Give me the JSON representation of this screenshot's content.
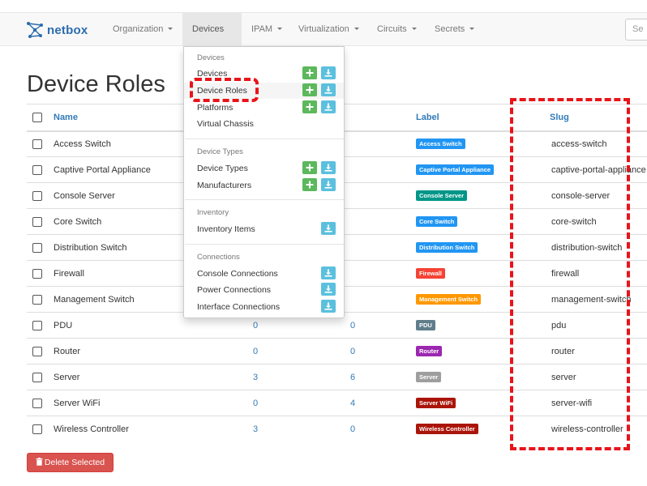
{
  "navbar": {
    "brand": "netbox",
    "items": [
      {
        "label": "Organization"
      },
      {
        "label": "Devices"
      },
      {
        "label": "IPAM"
      },
      {
        "label": "Virtualization"
      },
      {
        "label": "Circuits"
      },
      {
        "label": "Secrets"
      }
    ],
    "search_placeholder": "Se"
  },
  "page_title": "Device Roles",
  "table": {
    "headers": {
      "name": "Name",
      "label": "Label",
      "slug": "Slug"
    },
    "rows": [
      {
        "name": "Access Switch",
        "devices": "",
        "vms": "",
        "label": "Access Switch",
        "color": "#2196f3",
        "slug": "access-switch"
      },
      {
        "name": "Captive Portal Appliance",
        "devices": "",
        "vms": "",
        "label": "Captive Portal Appliance",
        "color": "#2196f3",
        "slug": "captive-portal-appliance"
      },
      {
        "name": "Console Server",
        "devices": "",
        "vms": "",
        "label": "Console Server",
        "color": "#009688",
        "slug": "console-server"
      },
      {
        "name": "Core Switch",
        "devices": "",
        "vms": "",
        "label": "Core Switch",
        "color": "#2196f3",
        "slug": "core-switch"
      },
      {
        "name": "Distribution Switch",
        "devices": "",
        "vms": "",
        "label": "Distribution Switch",
        "color": "#2196f3",
        "slug": "distribution-switch"
      },
      {
        "name": "Firewall",
        "devices": "",
        "vms": "",
        "label": "Firewall",
        "color": "#f44336",
        "slug": "firewall"
      },
      {
        "name": "Management Switch",
        "devices": "",
        "vms": "",
        "label": "Management Switch",
        "color": "#ff9800",
        "slug": "management-switch"
      },
      {
        "name": "PDU",
        "devices": "0",
        "vms": "0",
        "label": "PDU",
        "color": "#607d8b",
        "slug": "pdu"
      },
      {
        "name": "Router",
        "devices": "0",
        "vms": "0",
        "label": "Router",
        "color": "#9c27b0",
        "slug": "router"
      },
      {
        "name": "Server",
        "devices": "3",
        "vms": "6",
        "label": "Server",
        "color": "#9e9e9e",
        "slug": "server"
      },
      {
        "name": "Server WiFi",
        "devices": "0",
        "vms": "4",
        "label": "Server WiFi",
        "color": "#aa1409",
        "slug": "server-wifi"
      },
      {
        "name": "Wireless Controller",
        "devices": "3",
        "vms": "0",
        "label": "Wireless Controller",
        "color": "#aa1409",
        "slug": "wireless-controller"
      }
    ]
  },
  "delete_button": "Delete Selected",
  "devices_menu": {
    "sections": [
      {
        "header": "Devices",
        "items": [
          "Devices",
          "Device Roles",
          "Platforms",
          "Virtual Chassis"
        ]
      },
      {
        "header": "Device Types",
        "items": [
          "Device Types",
          "Manufacturers"
        ]
      },
      {
        "header": "Inventory",
        "items": [
          "Inventory Items"
        ]
      },
      {
        "header": "Connections",
        "items": [
          "Console Connections",
          "Power Connections",
          "Interface Connections"
        ]
      }
    ]
  },
  "colors": {
    "link": "#337ab7",
    "brand": "#2b6cae",
    "annotation": "#e8141a",
    "add": "#5cb85c",
    "import": "#5bc0de",
    "danger": "#d9534f"
  }
}
